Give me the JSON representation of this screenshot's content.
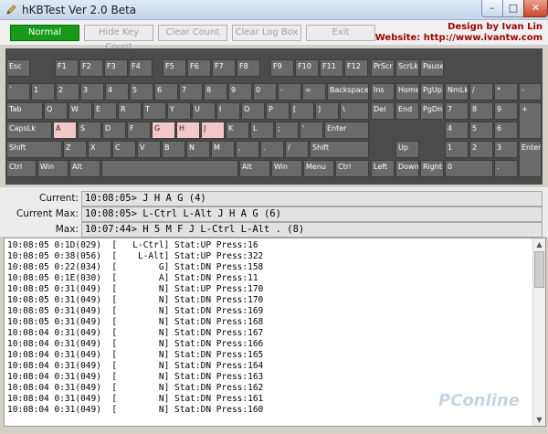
{
  "window": {
    "title": "hKBTest Ver 2.0 Beta",
    "controls": {
      "minimize": "–",
      "maximize": "□",
      "close": "✕"
    }
  },
  "toolbar": {
    "buttons": [
      "Normal",
      "Hide Key Count",
      "Clear Count",
      "Clear Log Box",
      "Exit"
    ],
    "active": "Normal",
    "credit_line1": "Design by Ivan Lin",
    "credit_line2": "Website: http://www.ivantw.com"
  },
  "keyboard": {
    "pressed_color": "#f4c8c8",
    "pressed": [
      "A",
      "G",
      "H",
      "J"
    ],
    "row1": [
      "Esc",
      "F1",
      "F2",
      "F3",
      "F4",
      "F5",
      "F6",
      "F7",
      "F8",
      "F9",
      "F10",
      "F11",
      "F12",
      "PrScr",
      "ScrLk",
      "Pause"
    ],
    "row2": [
      "`",
      "1",
      "2",
      "3",
      "4",
      "5",
      "6",
      "7",
      "8",
      "9",
      "0",
      "-",
      "=",
      "Backspace",
      "Ins",
      "Home",
      "PgUp",
      "NmLk",
      "/",
      "*",
      "-"
    ],
    "row3": [
      "Tab",
      "Q",
      "W",
      "E",
      "R",
      "T",
      "Y",
      "U",
      "I",
      "O",
      "P",
      "[",
      "]",
      "\\",
      "Del",
      "End",
      "PgDn",
      "7",
      "8",
      "9",
      "+"
    ],
    "row4": [
      "CapsLk",
      "A",
      "S",
      "D",
      "F",
      "G",
      "H",
      "J",
      "K",
      "L",
      ";",
      "'",
      "Enter",
      "4",
      "5",
      "6"
    ],
    "row5": [
      "Shift",
      "Z",
      "X",
      "C",
      "V",
      "B",
      "N",
      "M",
      ",",
      ".",
      "/",
      "Shift",
      "Up",
      "1",
      "2",
      "3",
      "Enter"
    ],
    "row6": [
      "Ctrl",
      "Win",
      "Alt",
      "Alt",
      "Win",
      "Menu",
      "Ctrl",
      "Left",
      "Down",
      "Right",
      "0",
      "."
    ]
  },
  "info": {
    "current_label": "Current:",
    "current_value": "10:08:05> J H A G (4)",
    "current_max_label": "Current Max:",
    "current_max_value": "10:08:05> L-Ctrl L-Alt J H A G (6)",
    "max_label": "Max:",
    "max_value": "10:07:44> H 5 M F J L-Ctrl L-Alt . (8)"
  },
  "log": [
    "10:08:05 0:1D(029)  [   L-Ctrl] Stat:UP Press:16",
    "10:08:05 0:38(056)  [    L-Alt] Stat:UP Press:322",
    "10:08:05 0:22(034)  [        G] Stat:DN Press:158",
    "10:08:05 0:1E(030)  [        A] Stat:DN Press:11",
    "10:08:05 0:31(049)  [        N] Stat:UP Press:170",
    "10:08:05 0:31(049)  [        N] Stat:DN Press:170",
    "10:08:05 0:31(049)  [        N] Stat:DN Press:169",
    "10:08:05 0:31(049)  [        N] Stat:DN Press:168",
    "10:08:04 0:31(049)  [        N] Stat:DN Press:167",
    "10:08:04 0:31(049)  [        N] Stat:DN Press:166",
    "10:08:04 0:31(049)  [        N] Stat:DN Press:165",
    "10:08:04 0:31(049)  [        N] Stat:DN Press:164",
    "10:08:04 0:31(049)  [        N] Stat:DN Press:163",
    "10:08:04 0:31(049)  [        N] Stat:DN Press:162",
    "10:08:04 0:31(049)  [        N] Stat:DN Press:161",
    "10:08:04 0:31(049)  [        N] Stat:DN Press:160"
  ],
  "watermark": "PConline"
}
